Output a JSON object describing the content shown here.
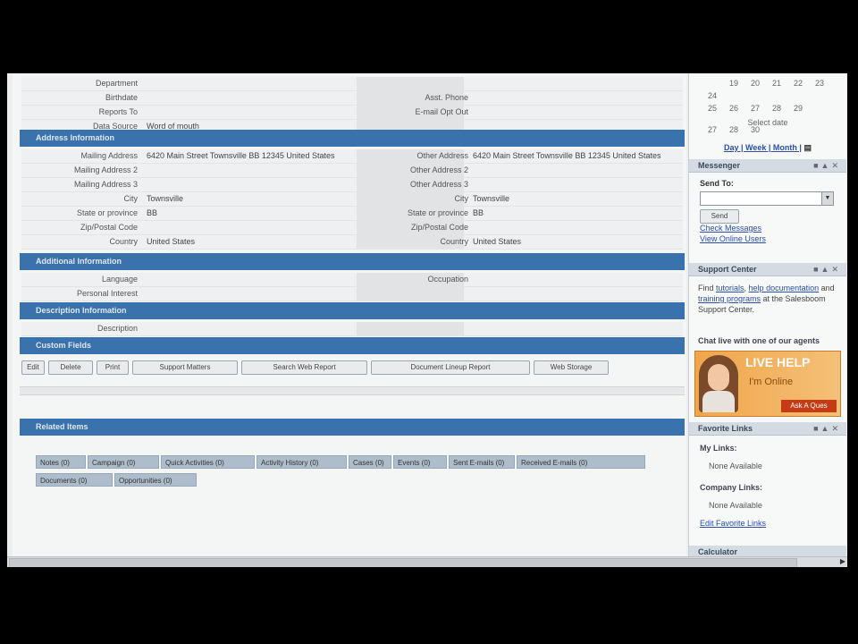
{
  "top_rows": [
    {
      "label": "Department",
      "value": "",
      "label2": "",
      "value2": ""
    },
    {
      "label": "Birthdate",
      "value": "",
      "label2": "Asst. Phone",
      "value2": ""
    },
    {
      "label": "Reports To",
      "value": "",
      "label2": "E-mail Opt Out",
      "value2": ""
    },
    {
      "label": "Data Source",
      "value": "Word of mouth",
      "label2": "",
      "value2": ""
    }
  ],
  "address_section": "Address Information",
  "address_rows": [
    {
      "label": "Mailing Address",
      "value": "6420 Main Street Townsville BB 12345 United States",
      "label2": "Other Address",
      "value2": "6420 Main Street Townsville BB 12345 United States"
    },
    {
      "label": "Mailing Address 2",
      "value": "",
      "label2": "Other Address 2",
      "value2": ""
    },
    {
      "label": "Mailing Address 3",
      "value": "",
      "label2": "Other Address 3",
      "value2": ""
    },
    {
      "label": "City",
      "value": "Townsville",
      "label2": "City",
      "value2": "Townsville"
    },
    {
      "label": "State or province",
      "value": "BB",
      "label2": "State or province",
      "value2": "BB"
    },
    {
      "label": "Zip/Postal Code",
      "value": "",
      "label2": "Zip/Postal Code",
      "value2": ""
    },
    {
      "label": "Country",
      "value": "United States",
      "label2": "Country",
      "value2": "United States"
    }
  ],
  "additional_section": "Additional Information",
  "additional_rows": [
    {
      "label": "Language",
      "value": "",
      "label2": "Occupation",
      "value2": ""
    },
    {
      "label": "Personal Interest",
      "value": "",
      "label2": "",
      "value2": ""
    }
  ],
  "description_section": "Description Information",
  "description_rows": [
    {
      "label": "Description",
      "value": "",
      "label2": "",
      "value2": ""
    }
  ],
  "custom_section": "Custom Fields",
  "buttons": [
    "Edit",
    "Delete",
    "Print",
    "Support Matters",
    "Search Web Report",
    "Document Lineup Report",
    "Web Storage"
  ],
  "related_section": "Related Items",
  "related_tabs": [
    [
      "Notes (0)",
      "Campaign (0)",
      "Quick Activities (0)",
      "Activity History (0)",
      "Cases (0)",
      "Events (0)",
      "Sent E-mails (0)",
      "Received E-mails (0)"
    ],
    [
      "Documents (0)",
      "Opportunities (0)"
    ]
  ],
  "sidebar": {
    "calendar_rows": [
      [
        "",
        "19",
        "20",
        "21",
        "22",
        "23",
        "24"
      ],
      [
        "25",
        "26",
        "27",
        "28",
        "29",
        "",
        ""
      ],
      [
        "27",
        "28",
        "30",
        "",
        "",
        "",
        ""
      ]
    ],
    "select_date": "Select date",
    "day_week_month": "Day | Week | Month |",
    "messenger_title": "Messenger",
    "send_to_label": "Send To:",
    "send_button": "Send",
    "check_messages": "Check Messages",
    "view_online": "View Online Users",
    "support_title": "Support Center",
    "support_text_1": "Find ",
    "support_link_1": "tutorials",
    "support_link_2": "help documentation",
    "support_text_2": " and ",
    "support_link_3": "training programs",
    "support_text_3": " at the Salesboom Support Center.",
    "chat_text": "Chat live with one of our agents",
    "live_help": "LIVE HELP",
    "im_online": "I'm Online",
    "ask_me": "Ask A Ques",
    "favorite_title": "Favorite Links",
    "my_links": "My Links:",
    "none_avail_1": "None Available",
    "company_links": "Company Links:",
    "none_avail_2": "None Available",
    "edit_favorite": "Edit Favorite Links",
    "calculator_title": "Calculator"
  },
  "colors": {
    "section_blue": "#3a72ad",
    "tab_blue": "#aebdcc"
  }
}
